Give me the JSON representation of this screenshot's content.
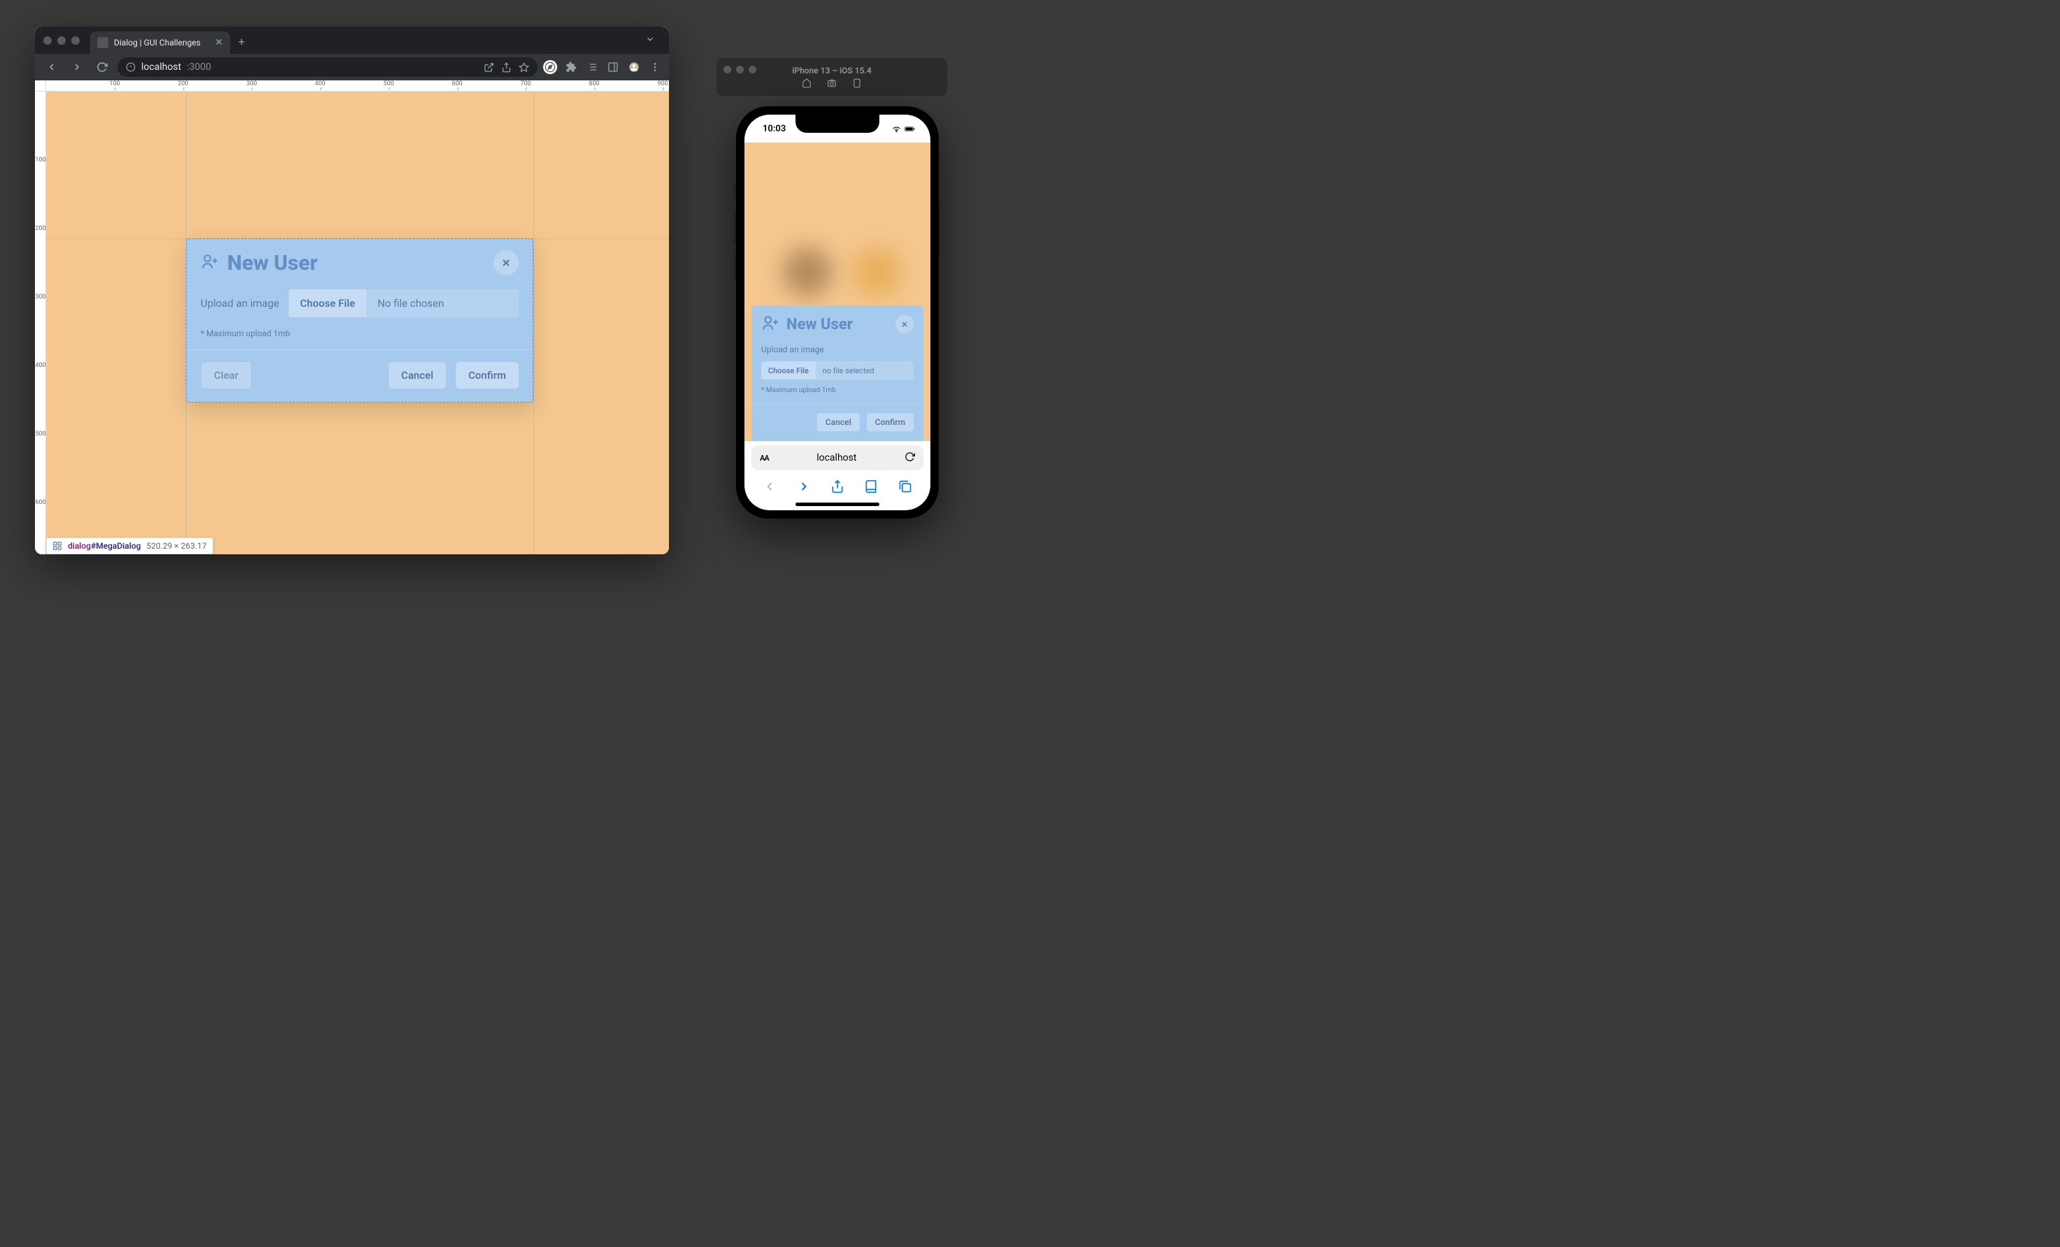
{
  "browser": {
    "tab_title": "Dialog | GUI Challenges",
    "url_host": "localhost",
    "url_port": ":3000",
    "ruler_h": [
      "100",
      "200",
      "300",
      "400",
      "500",
      "600",
      "700",
      "800",
      "900"
    ],
    "ruler_v": [
      "100",
      "200",
      "300",
      "400",
      "500",
      "600"
    ]
  },
  "dialog": {
    "title": "New User",
    "upload_label": "Upload an image",
    "choose_file_label": "Choose File",
    "no_file_label": "No file chosen",
    "hint": "* Maximum upload 1mb",
    "clear_label": "Clear",
    "cancel_label": "Cancel",
    "confirm_label": "Confirm"
  },
  "element_badge": {
    "selector_tag": "dialog",
    "selector_id": "#MegaDialog",
    "dimensions": "520.29 × 263.17"
  },
  "simulator": {
    "device_title": "iPhone 13 – iOS 15.4",
    "status_time": "10:03",
    "safari_host": "localhost",
    "aa_label": "AA"
  },
  "mobile_dialog": {
    "title": "New User",
    "upload_label": "Upload an image",
    "choose_file_label": "Choose File",
    "no_file_label": "no file selected",
    "hint": "* Maximum upload 1mb",
    "cancel_label": "Cancel",
    "confirm_label": "Confirm"
  }
}
